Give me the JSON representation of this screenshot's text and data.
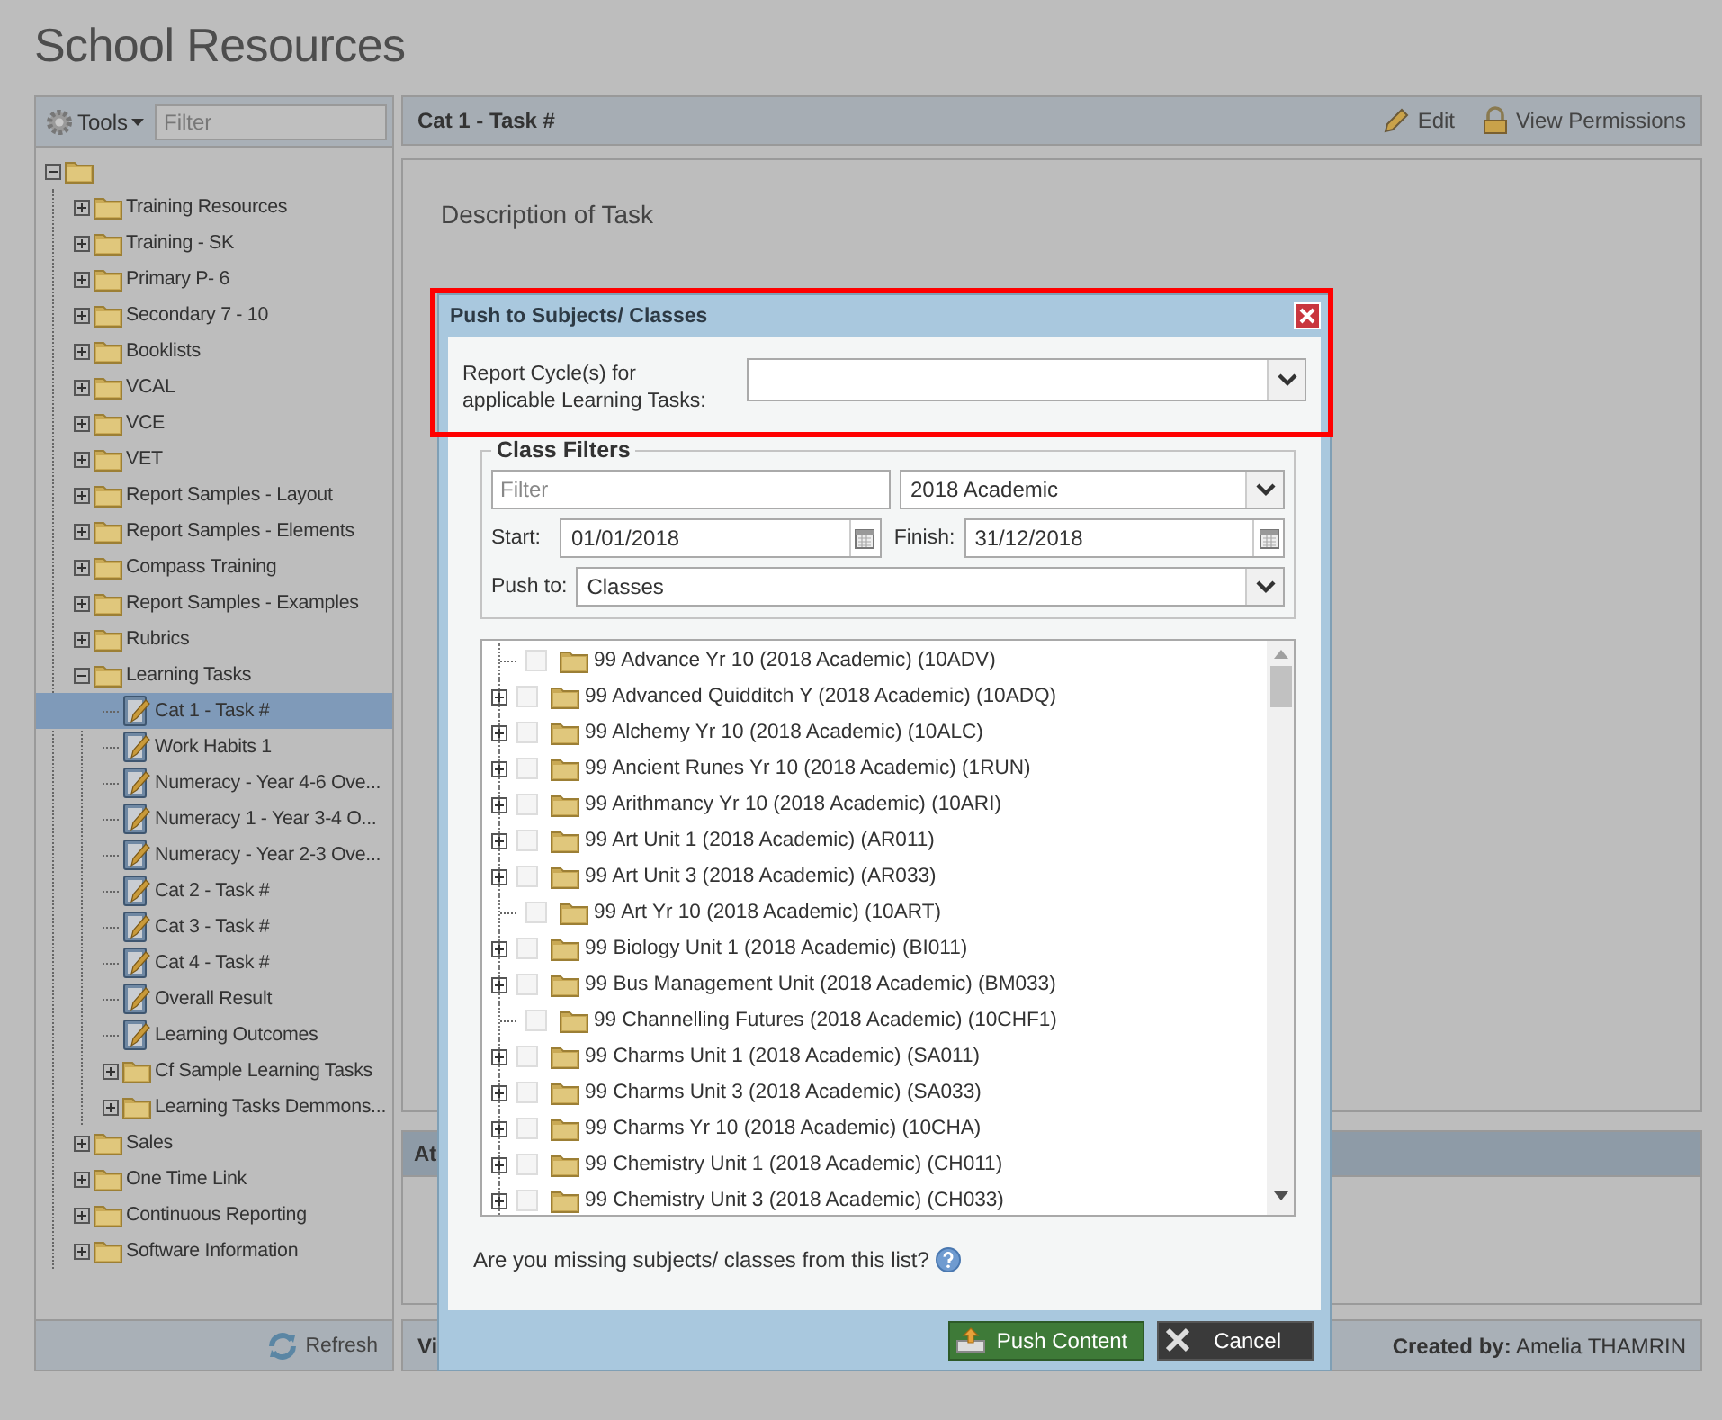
{
  "title": "School Resources",
  "sidebar": {
    "tools_label": "Tools",
    "filter_placeholder": "Filter",
    "refresh_label": "Refresh",
    "tree": [
      {
        "kind": "folder",
        "expanded": true,
        "selected": false,
        "children": [
          {
            "kind": "folder",
            "label": "Training Resources",
            "expanded": false,
            "selected": false
          },
          {
            "kind": "folder",
            "label": "Training - SK",
            "expanded": false,
            "selected": false
          },
          {
            "kind": "folder",
            "label": "Primary P- 6",
            "expanded": false,
            "selected": false
          },
          {
            "kind": "folder",
            "label": "Secondary 7 - 10",
            "expanded": false,
            "selected": false
          },
          {
            "kind": "folder",
            "label": "Booklists",
            "expanded": false,
            "selected": false
          },
          {
            "kind": "folder",
            "label": "VCAL",
            "expanded": false,
            "selected": false
          },
          {
            "kind": "folder",
            "label": "VCE",
            "expanded": false,
            "selected": false
          },
          {
            "kind": "folder",
            "label": "VET",
            "expanded": false,
            "selected": false
          },
          {
            "kind": "folder",
            "label": "Report Samples - Layout",
            "expanded": false,
            "selected": false
          },
          {
            "kind": "folder",
            "label": "Report Samples - Elements",
            "expanded": false,
            "selected": false
          },
          {
            "kind": "folder",
            "label": "Compass Training",
            "expanded": false,
            "selected": false
          },
          {
            "kind": "folder",
            "label": "Report Samples - Examples",
            "expanded": false,
            "selected": false
          },
          {
            "kind": "folder",
            "label": "Rubrics",
            "expanded": false,
            "selected": false
          },
          {
            "kind": "folder",
            "label": "Learning Tasks",
            "expanded": true,
            "selected": false,
            "children": [
              {
                "kind": "task",
                "label": "Cat 1 - Task #",
                "selected": true
              },
              {
                "kind": "task",
                "label": "Work Habits 1",
                "selected": false
              },
              {
                "kind": "task",
                "label": "Numeracy - Year 4-6 Ove...",
                "selected": false
              },
              {
                "kind": "task",
                "label": "Numeracy 1 - Year 3-4 O...",
                "selected": false
              },
              {
                "kind": "task",
                "label": "Numeracy - Year 2-3 Ove...",
                "selected": false
              },
              {
                "kind": "task",
                "label": "Cat 2 - Task #",
                "selected": false
              },
              {
                "kind": "task",
                "label": "Cat 3 - Task #",
                "selected": false
              },
              {
                "kind": "task",
                "label": "Cat 4 - Task #",
                "selected": false
              },
              {
                "kind": "task",
                "label": "Overall Result",
                "selected": false
              },
              {
                "kind": "task",
                "label": "Learning Outcomes",
                "selected": false
              },
              {
                "kind": "folder",
                "label": "Cf Sample Learning Tasks",
                "expanded": false,
                "selected": false
              },
              {
                "kind": "folder",
                "label": "Learning Tasks Demmons...",
                "expanded": false,
                "selected": false
              }
            ]
          },
          {
            "kind": "folder",
            "label": "Sales",
            "expanded": false,
            "selected": false
          },
          {
            "kind": "folder",
            "label": "One Time Link",
            "expanded": false,
            "selected": false
          },
          {
            "kind": "folder",
            "label": "Continuous Reporting",
            "expanded": false,
            "selected": false
          },
          {
            "kind": "folder",
            "label": "Software Information",
            "expanded": false,
            "selected": false
          }
        ]
      }
    ]
  },
  "main": {
    "header_title": "Cat 1 - Task #",
    "edit_label": "Edit",
    "permissions_label": "View Permissions",
    "description": "Description of Task",
    "attachments_header": "At",
    "status_left": "Vi",
    "created_by_label": "Created by:",
    "created_by": "Amelia THAMRIN"
  },
  "dialog": {
    "title": "Push to Subjects/ Classes",
    "report_cycle_label": "Report Cycle(s) for applicable Learning Tasks:",
    "filters": {
      "legend": "Class Filters",
      "filter_placeholder": "Filter",
      "term": "2018 Academic",
      "start_label": "Start:",
      "start": "01/01/2018",
      "finish_label": "Finish:",
      "finish": "31/12/2018",
      "push_to_label": "Push to:",
      "push_to": "Classes"
    },
    "classes": [
      {
        "label": "99 Advance Yr 10 (2018 Academic) (10ADV)",
        "expandable": false,
        "checked": false
      },
      {
        "label": "99 Advanced Quidditch Y (2018 Academic) (10ADQ)",
        "expandable": true,
        "checked": false
      },
      {
        "label": "99 Alchemy Yr 10 (2018 Academic) (10ALC)",
        "expandable": true,
        "checked": false
      },
      {
        "label": "99 Ancient Runes Yr 10 (2018 Academic) (1RUN)",
        "expandable": true,
        "checked": false
      },
      {
        "label": "99 Arithmancy Yr 10 (2018 Academic) (10ARI)",
        "expandable": true,
        "checked": false
      },
      {
        "label": "99 Art Unit 1 (2018 Academic) (AR011)",
        "expandable": true,
        "checked": false
      },
      {
        "label": "99 Art Unit 3 (2018 Academic) (AR033)",
        "expandable": true,
        "checked": false
      },
      {
        "label": "99 Art Yr 10 (2018 Academic) (10ART)",
        "expandable": false,
        "checked": false
      },
      {
        "label": "99 Biology Unit 1 (2018 Academic) (BI011)",
        "expandable": true,
        "checked": false
      },
      {
        "label": "99 Bus Management Unit (2018 Academic) (BM033)",
        "expandable": true,
        "checked": false
      },
      {
        "label": "99 Channelling Futures (2018 Academic) (10CHF1)",
        "expandable": false,
        "checked": false
      },
      {
        "label": "99 Charms Unit 1 (2018 Academic) (SA011)",
        "expandable": true,
        "checked": false
      },
      {
        "label": "99 Charms Unit 3 (2018 Academic) (SA033)",
        "expandable": true,
        "checked": false
      },
      {
        "label": "99 Charms Yr 10 (2018 Academic) (10CHA)",
        "expandable": true,
        "checked": false
      },
      {
        "label": "99 Chemistry Unit 1 (2018 Academic) (CH011)",
        "expandable": true,
        "checked": false
      },
      {
        "label": "99 Chemistry Unit 3 (2018 Academic) (CH033)",
        "expandable": true,
        "checked": false
      }
    ],
    "help_text": "Are you missing subjects/ classes from this list?",
    "push_label": "Push Content",
    "cancel_label": "Cancel"
  }
}
